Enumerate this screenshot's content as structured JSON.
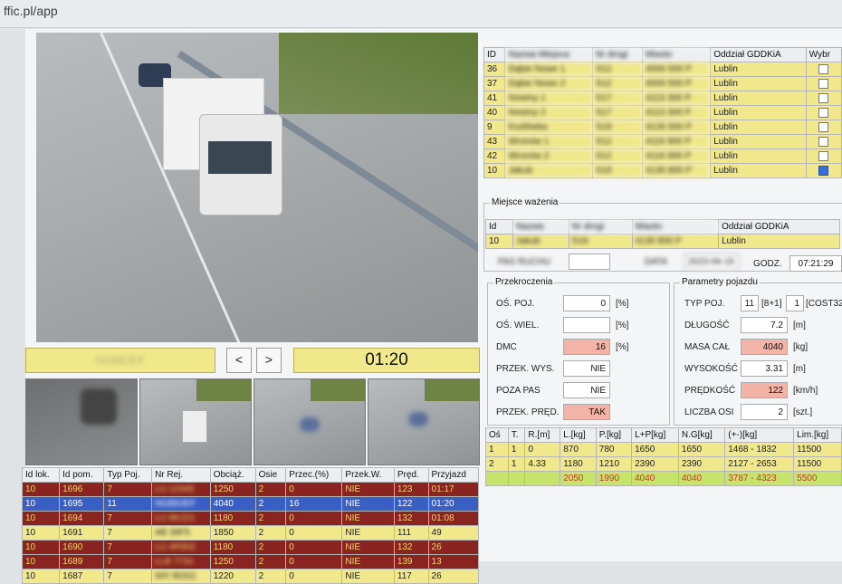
{
  "browser": {
    "url_fragment": "ffic.pl/app"
  },
  "camera": {
    "plate_text": "NGB6JEF",
    "time": "01:20",
    "prev_label": "<",
    "next_label": ">"
  },
  "locations_table": {
    "headers": [
      "ID",
      "Nazwa Miejsca",
      "Nr drogi",
      "Miasto",
      "Oddział GDDKiA",
      "Wybr"
    ],
    "rows": [
      {
        "id": "36",
        "name": "Dąbie Nowe 1",
        "road": "S12",
        "city": "4000 500 P",
        "branch": "Lublin",
        "sel": false
      },
      {
        "id": "37",
        "name": "Dąbie Nowe 2",
        "road": "S12",
        "city": "4000 500 P",
        "branch": "Lublin",
        "sel": false
      },
      {
        "id": "41",
        "name": "Nowiny 1",
        "road": "S17",
        "city": "4113 300 P",
        "branch": "Lublin",
        "sel": false
      },
      {
        "id": "40",
        "name": "Nowiny 2",
        "road": "S17",
        "city": "4113 300 P",
        "branch": "Lublin",
        "sel": false
      },
      {
        "id": "9",
        "name": "Kozłówka",
        "road": "S19",
        "city": "4126 500 P",
        "branch": "Lublin",
        "sel": false
      },
      {
        "id": "43",
        "name": "Wronów 1",
        "road": "S12",
        "city": "4116 900 P",
        "branch": "Lublin",
        "sel": false
      },
      {
        "id": "42",
        "name": "Wronów 2",
        "road": "S12",
        "city": "4116 900 P",
        "branch": "Lublin",
        "sel": false
      },
      {
        "id": "10",
        "name": "Jakub",
        "road": "S19",
        "city": "4130 800 P",
        "branch": "Lublin",
        "sel": true
      }
    ]
  },
  "location_panel": {
    "title": "Miejsce ważenia",
    "headers": [
      "Id",
      "Nazwa",
      "Nr drogi",
      "Miasto",
      "Oddział GDDKiA"
    ],
    "row": {
      "id": "10",
      "name": "Jakub",
      "road": "S19",
      "city": "4130 800 P",
      "branch": "Lublin"
    },
    "pas_label": "PAS RUCHU",
    "data_label": "DATA",
    "data_value": "2023-06-15",
    "godz_label": "GODZ.",
    "godz_value": "07:21:29"
  },
  "exceed": {
    "title": "Przekroczenia",
    "os_poj": {
      "label": "OŚ. POJ.",
      "value": "0",
      "unit": "[%]"
    },
    "os_wiel": {
      "label": "OŚ. WIEL.",
      "value": "",
      "unit": "[%]"
    },
    "dmc": {
      "label": "DMC",
      "value": "16",
      "unit": "[%]"
    },
    "wys": {
      "label": "PRZEK. WYS.",
      "value": "NIE"
    },
    "pas": {
      "label": "POZA PAS",
      "value": "NIE"
    },
    "pred": {
      "label": "PRZEK. PRĘD.",
      "value": "TAK"
    }
  },
  "vehicle": {
    "title": "Parametry pojazdu",
    "typ": {
      "label": "TYP POJ.",
      "value": "11",
      "code": "[8+1]",
      "value2": "1",
      "code2": "[COST32"
    },
    "dlug": {
      "label": "DŁUGOŚĆ",
      "value": "7.2",
      "unit": "[m]"
    },
    "masa": {
      "label": "MASA CAŁ",
      "value": "4040",
      "unit": "[kg]"
    },
    "wys": {
      "label": "WYSOKOŚĆ",
      "value": "3.31",
      "unit": "[m]"
    },
    "pred": {
      "label": "PRĘDKOŚĆ",
      "value": "122",
      "unit": "[km/h]"
    },
    "osie": {
      "label": "LICZBA OSI",
      "value": "2",
      "unit": "[szt.]"
    }
  },
  "axles": {
    "headers": [
      "Oś",
      "T.",
      "R.[m]",
      "L.[kg]",
      "P.[kg]",
      "L+P[kg]",
      "N.G[kg]",
      "(+-)[kg]",
      "Lim.[kg]"
    ],
    "rows": [
      {
        "os": "1",
        "t": "1",
        "r": "0",
        "l": "870",
        "p": "780",
        "lp": "1650",
        "ng": "1650",
        "pm": "1468 - 1832",
        "lim": "11500"
      },
      {
        "os": "2",
        "t": "1",
        "r": "4.33",
        "l": "1180",
        "p": "1210",
        "lp": "2390",
        "ng": "2390",
        "pm": "2127 - 2653",
        "lim": "11500"
      }
    ],
    "sum": {
      "os": "",
      "t": "",
      "r": "",
      "l": "2050",
      "p": "1990",
      "lp": "4040",
      "ng": "4040",
      "pm": "3787 - 4323",
      "lim": "5500"
    }
  },
  "records": {
    "headers": [
      "Id lok.",
      "Id pom.",
      "Typ Poj.",
      "Nr Rej.",
      "Obciąż.",
      "Osie",
      "Przec.(%)",
      "Przek.W.",
      "Pręd.",
      "Przyjazd"
    ],
    "rows": [
      {
        "c": "red",
        "lok": "10",
        "pom": "1696",
        "typ": "7",
        "rej": "LU 12345",
        "obc": "1250",
        "osie": "2",
        "prz": "0",
        "pw": "NIE",
        "pred": "123",
        "przy": "01:17"
      },
      {
        "c": "blue",
        "lok": "10",
        "pom": "1695",
        "typ": "11",
        "rej": "NGB6JEF",
        "obc": "4040",
        "osie": "2",
        "prz": "16",
        "pw": "NIE",
        "pred": "122",
        "przy": "01:20"
      },
      {
        "c": "red",
        "lok": "10",
        "pom": "1694",
        "typ": "7",
        "rej": "LU 8K221",
        "obc": "1180",
        "osie": "2",
        "prz": "0",
        "pw": "NIE",
        "pred": "132",
        "przy": "01:08"
      },
      {
        "c": "yel",
        "lok": "10",
        "pom": "1691",
        "typ": "7",
        "rej": "AB 39F5",
        "obc": "1850",
        "osie": "2",
        "prz": "0",
        "pw": "NIE",
        "pred": "111",
        "przy": "49"
      },
      {
        "c": "red",
        "lok": "10",
        "pom": "1690",
        "typ": "7",
        "rej": "LU 4R902",
        "obc": "1180",
        "osie": "2",
        "prz": "0",
        "pw": "NIE",
        "pred": "132",
        "przy": "26"
      },
      {
        "c": "red",
        "lok": "10",
        "pom": "1689",
        "typ": "7",
        "rej": "LLB 7731",
        "obc": "1250",
        "osie": "2",
        "prz": "0",
        "pw": "NIE",
        "pred": "139",
        "przy": "13"
      },
      {
        "c": "yel",
        "lok": "10",
        "pom": "1687",
        "typ": "7",
        "rej": "WX 90311",
        "obc": "1220",
        "osie": "2",
        "prz": "0",
        "pw": "NIE",
        "pred": "117",
        "przy": "26"
      }
    ]
  },
  "colors": {
    "yellow": "#f1e78b",
    "red_row": "#8a2420",
    "blue_row": "#3a5fc4",
    "alert": "#f4b3a7"
  }
}
